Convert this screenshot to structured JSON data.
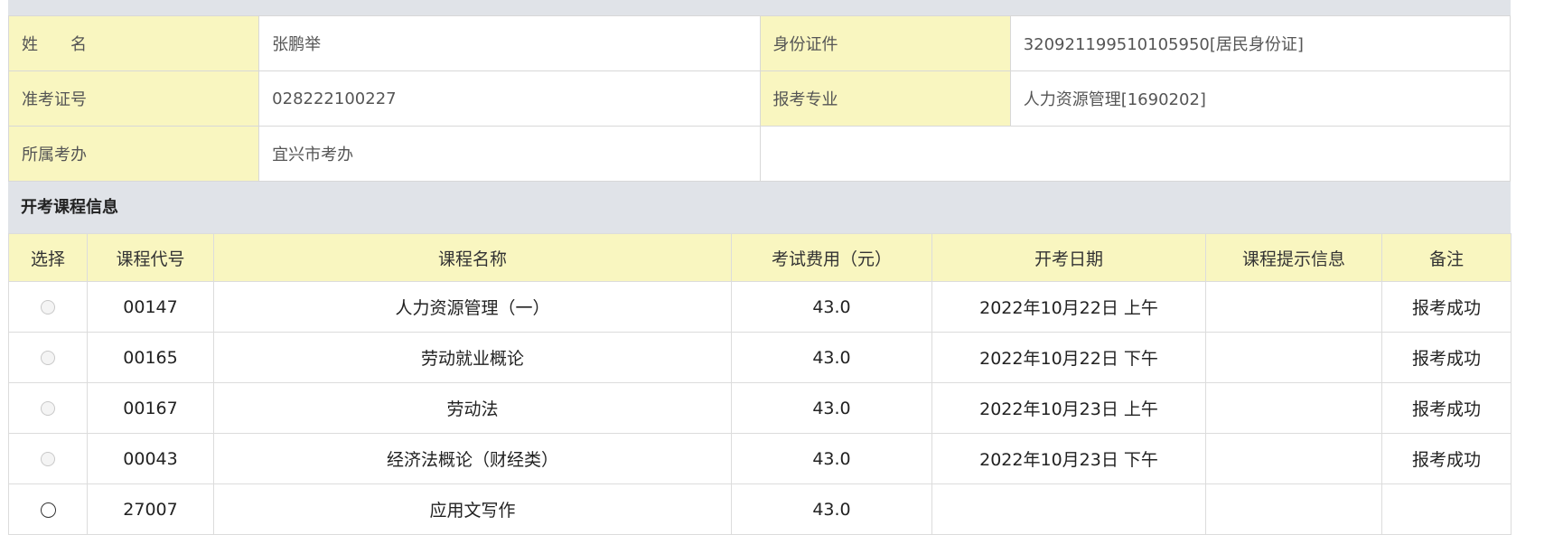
{
  "student": {
    "name_label": "姓　　名",
    "name": "张鹏举",
    "id_label": "身份证件",
    "id_value": "320921199510105950[居民身份证]",
    "ticket_label": "准考证号",
    "ticket_value": "028222100227",
    "major_label": "报考专业",
    "major_value": "人力资源管理[1690202]",
    "office_label": "所属考办",
    "office_value": "宜兴市考办"
  },
  "section_title": "开考课程信息",
  "columns": [
    "选择",
    "课程代号",
    "课程名称",
    "考试费用（元）",
    "开考日期",
    "课程提示信息",
    "备注"
  ],
  "courses": [
    {
      "code": "00147",
      "name": "人力资源管理（一）",
      "fee": "43.0",
      "date": "2022年10月22日 上午",
      "tip": "",
      "remark": "报考成功",
      "selectable": false
    },
    {
      "code": "00165",
      "name": "劳动就业概论",
      "fee": "43.0",
      "date": "2022年10月22日 下午",
      "tip": "",
      "remark": "报考成功",
      "selectable": false
    },
    {
      "code": "00167",
      "name": "劳动法",
      "fee": "43.0",
      "date": "2022年10月23日 上午",
      "tip": "",
      "remark": "报考成功",
      "selectable": false
    },
    {
      "code": "00043",
      "name": "经济法概论（财经类）",
      "fee": "43.0",
      "date": "2022年10月23日 下午",
      "tip": "",
      "remark": "报考成功",
      "selectable": false
    },
    {
      "code": "27007",
      "name": "应用文写作",
      "fee": "43.0",
      "date": "",
      "tip": "",
      "remark": "",
      "selectable": true
    }
  ],
  "colors": {
    "label_bg": "#f9f6c0",
    "section_bg": "#e0e3e8",
    "success": "#e8302a"
  }
}
